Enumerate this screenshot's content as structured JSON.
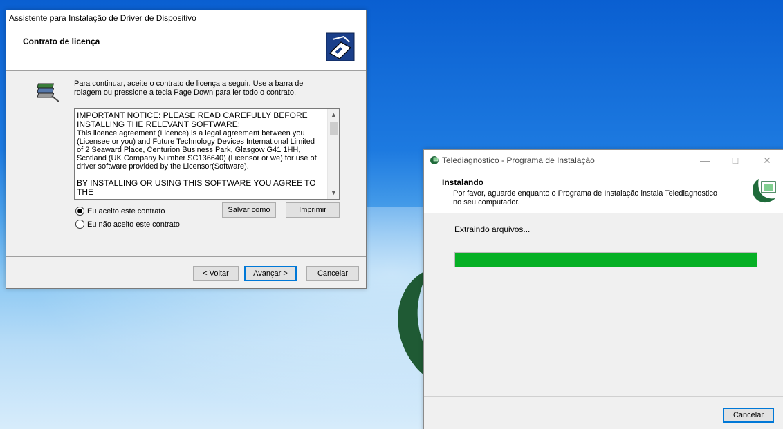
{
  "wizard": {
    "title": "Assistente para Instalação de Driver de Dispositivo",
    "header_title": "Contrato de licença",
    "intro_line1": "Para continuar, aceite o contrato de licença a seguir. Use a barra de",
    "intro_line2": "rolagem ou pressione a tecla Page Down para ler todo o contrato.",
    "license_lines": [
      "IMPORTANT NOTICE: PLEASE READ CAREFULLY BEFORE",
      "INSTALLING THE RELEVANT SOFTWARE:",
      "This licence agreement (Licence) is a legal agreement between you",
      "(Licensee or you) and Future Technology Devices International Limited",
      "of 2 Seaward Place, Centurion Business Park, Glasgow G41 1HH,",
      "Scotland (UK Company Number SC136640) (Licensor or we) for use of",
      "driver software provided by the Licensor(Software).",
      "BY INSTALLING OR USING THIS SOFTWARE YOU AGREE TO THE"
    ],
    "radio_accept": "Eu aceito este contrato",
    "radio_decline": "Eu não aceito este contrato",
    "accept_selected": true,
    "save_label": "Salvar como",
    "print_label": "Imprimir",
    "back_label": "< Voltar",
    "next_label": "Avançar >",
    "cancel_label": "Cancelar"
  },
  "setup": {
    "title": "Telediagnostico - Programa de Instalação",
    "header_title": "Instalando",
    "header_sub_line1": "Por favor, aguarde enquanto o Programa de Instalação instala Telediagnostico",
    "header_sub_line2": "no seu computador.",
    "status": "Extraindo arquivos...",
    "progress_percent": 100,
    "cancel_label": "Cancelar"
  },
  "colors": {
    "progress_fill": "#06b025",
    "brand_green": "#1f6b3a",
    "desktop_blue": "#0a5fd1"
  }
}
